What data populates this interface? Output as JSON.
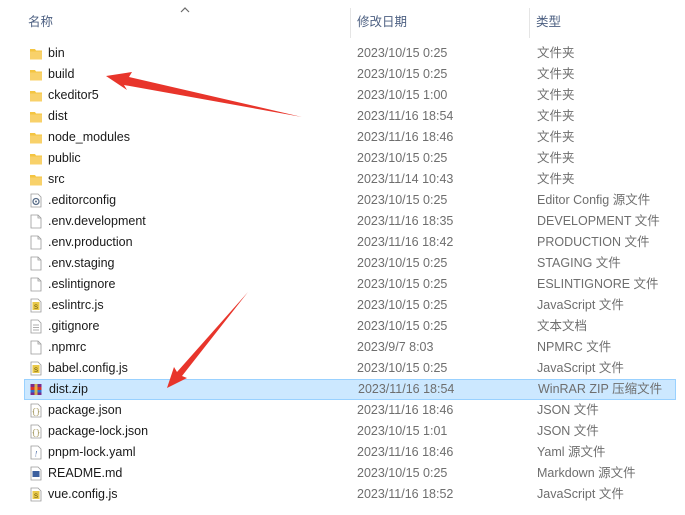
{
  "columns": {
    "name": "名称",
    "date": "修改日期",
    "type": "类型"
  },
  "files": [
    {
      "name": "bin",
      "date": "2023/10/15 0:25",
      "type": "文件夹",
      "icon": "folder-icon"
    },
    {
      "name": "build",
      "date": "2023/10/15 0:25",
      "type": "文件夹",
      "icon": "folder-icon"
    },
    {
      "name": "ckeditor5",
      "date": "2023/10/15 1:00",
      "type": "文件夹",
      "icon": "folder-icon"
    },
    {
      "name": "dist",
      "date": "2023/11/16 18:54",
      "type": "文件夹",
      "icon": "folder-icon"
    },
    {
      "name": "node_modules",
      "date": "2023/11/16 18:46",
      "type": "文件夹",
      "icon": "folder-icon"
    },
    {
      "name": "public",
      "date": "2023/10/15 0:25",
      "type": "文件夹",
      "icon": "folder-icon"
    },
    {
      "name": "src",
      "date": "2023/11/14 10:43",
      "type": "文件夹",
      "icon": "folder-icon"
    },
    {
      "name": ".editorconfig",
      "date": "2023/10/15 0:25",
      "type": "Editor Config 源文件",
      "icon": "config-file-icon"
    },
    {
      "name": ".env.development",
      "date": "2023/11/16 18:35",
      "type": "DEVELOPMENT 文件",
      "icon": "blank-file-icon"
    },
    {
      "name": ".env.production",
      "date": "2023/11/16 18:42",
      "type": "PRODUCTION 文件",
      "icon": "blank-file-icon"
    },
    {
      "name": ".env.staging",
      "date": "2023/10/15 0:25",
      "type": "STAGING 文件",
      "icon": "blank-file-icon"
    },
    {
      "name": ".eslintignore",
      "date": "2023/10/15 0:25",
      "type": "ESLINTIGNORE 文件",
      "icon": "blank-file-icon"
    },
    {
      "name": ".eslintrc.js",
      "date": "2023/10/15 0:25",
      "type": "JavaScript 文件",
      "icon": "js-file-icon"
    },
    {
      "name": ".gitignore",
      "date": "2023/10/15 0:25",
      "type": "文本文档",
      "icon": "text-file-icon"
    },
    {
      "name": ".npmrc",
      "date": "2023/9/7 8:03",
      "type": "NPMRC 文件",
      "icon": "blank-file-icon"
    },
    {
      "name": "babel.config.js",
      "date": "2023/10/15 0:25",
      "type": "JavaScript 文件",
      "icon": "js-file-icon"
    },
    {
      "name": "dist.zip",
      "date": "2023/11/16 18:54",
      "type": "WinRAR ZIP 压缩文件",
      "icon": "winrar-archive-icon",
      "selected": true
    },
    {
      "name": "package.json",
      "date": "2023/11/16 18:46",
      "type": "JSON 文件",
      "icon": "json-file-icon"
    },
    {
      "name": "package-lock.json",
      "date": "2023/10/15 1:01",
      "type": "JSON 文件",
      "icon": "json-file-icon"
    },
    {
      "name": "pnpm-lock.yaml",
      "date": "2023/11/16 18:46",
      "type": "Yaml 源文件",
      "icon": "yaml-file-icon"
    },
    {
      "name": "README.md",
      "date": "2023/10/15 0:25",
      "type": "Markdown 源文件",
      "icon": "markdown-file-icon"
    },
    {
      "name": "vue.config.js",
      "date": "2023/11/16 18:52",
      "type": "JavaScript 文件",
      "icon": "js-file-icon"
    }
  ],
  "colors": {
    "folder": "#f4c542",
    "selection": "#cce8ff",
    "annotation": "#e8352b"
  }
}
